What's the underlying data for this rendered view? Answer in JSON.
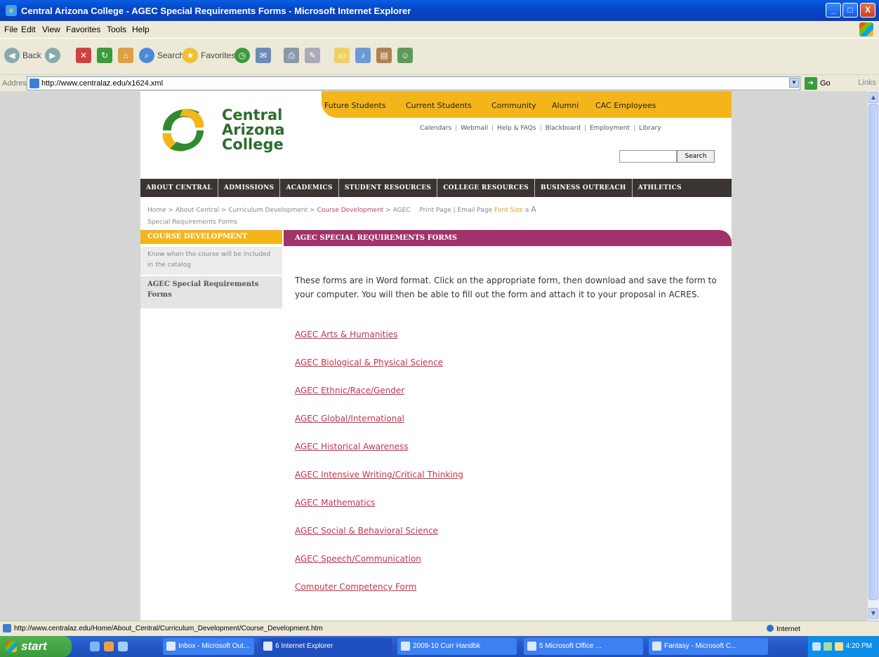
{
  "window": {
    "title": "Central Arizona College - AGEC Special Requirements Forms - Microsoft Internet Explorer",
    "controls": [
      "_",
      "□",
      "X"
    ]
  },
  "menubar": [
    "File",
    "Edit",
    "View",
    "Favorites",
    "Tools",
    "Help"
  ],
  "toolbar": {
    "back": "Back",
    "search": "Search",
    "favorites": "Favorites"
  },
  "address": {
    "label": "Address",
    "url": "http://www.centralaz.edu/x1624.xml",
    "go": "Go",
    "links": "Links"
  },
  "site": {
    "logo": [
      "Central",
      "Arizona",
      "College"
    ],
    "topnav": [
      "Future Students",
      "Current Students",
      "Community",
      "Alumni",
      "CAC Employees"
    ],
    "utility": [
      "Calendars",
      "Webmail",
      "Help & FAQs",
      "Blackboard",
      "Employment",
      "Library"
    ],
    "search_button": "Search",
    "mainnav": [
      "ABOUT CENTRAL",
      "ADMISSIONS",
      "ACADEMICS",
      "STUDENT RESOURCES",
      "COLLEGE RESOURCES",
      "BUSINESS OUTREACH",
      "ATHLETICS"
    ],
    "breadcrumb": {
      "home": "Home",
      "about": "About Central",
      "curriculum": "Curriculum Development",
      "course": "Course Development",
      "current_a": "AGEC",
      "current_b": "Special Requirements Forms",
      "print": "Print Page",
      "email": "Email Page",
      "font_size": "Font Size",
      "font_a": "a",
      "font_A": "A"
    },
    "sidebar": {
      "heading": "COURSE DEVELOPMENT",
      "items": [
        "Know when the course will be included in the catalog",
        "AGEC Special Requirements Forms"
      ]
    },
    "content": {
      "heading": "AGEC SPECIAL REQUIREMENTS FORMS",
      "intro": "These forms are in Word format.  Click on the appropriate form, then download and save the form to your computer.  You will then be able to fill out the form and attach it to your proposal in ACRES.",
      "forms": [
        "AGEC Arts & Humanities",
        "AGEC Biological & Physical Science",
        "AGEC Ethnic/Race/Gender",
        "AGEC Global/International",
        "AGEC Historical Awareness",
        "AGEC Intensive Writing/Critical Thinking",
        "AGEC Mathematics",
        "AGEC Social & Behavioral Science",
        "AGEC Speech/Communication",
        "Computer Competency Form"
      ]
    }
  },
  "statusbar": {
    "url": "http://www.centralaz.edu/Home/About_Central/Curriculum_Development/Course_Development.htm",
    "zone": "Internet"
  },
  "taskbar": {
    "start": "start",
    "tasks": [
      "Inbox - Microsoft Out...",
      "6 Internet Explorer",
      "2009-10 Curr Handbk",
      "5 Microsoft Office ...",
      "Fantasy - Microsoft C..."
    ],
    "clock": "4:20 PM"
  },
  "colors": {
    "brand_gold": "#f4b51a",
    "brand_magenta": "#a2326a",
    "brand_green": "#2e6b2e",
    "nav_dark": "#3b3430",
    "link": "#c2334f"
  }
}
